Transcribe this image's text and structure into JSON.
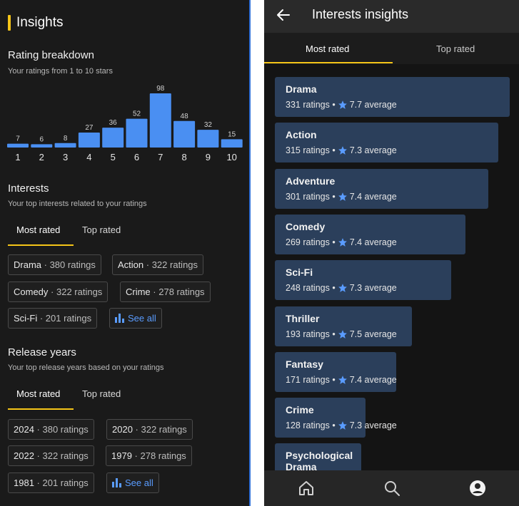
{
  "left": {
    "title": "Insights",
    "rating_breakdown": {
      "heading": "Rating breakdown",
      "subtitle": "Your ratings from 1 to 10 stars"
    },
    "interests": {
      "heading": "Interests",
      "subtitle": "Your top interests related to your ratings",
      "tabs": [
        "Most rated",
        "Top rated"
      ],
      "chips": [
        {
          "name": "Drama",
          "count": "· 380 ratings"
        },
        {
          "name": "Action",
          "count": "· 322 ratings"
        },
        {
          "name": "Comedy",
          "count": "· 322 ratings"
        },
        {
          "name": "Crime",
          "count": "· 278 ratings"
        },
        {
          "name": "Sci-Fi",
          "count": "· 201 ratings"
        }
      ],
      "see_all": "See all"
    },
    "release_years": {
      "heading": "Release years",
      "subtitle": "Your top release years based on your ratings",
      "tabs": [
        "Most rated",
        "Top rated"
      ],
      "chips": [
        {
          "name": "2024",
          "count": "· 380 ratings"
        },
        {
          "name": "2020",
          "count": "· 322 ratings"
        },
        {
          "name": "2022",
          "count": "· 322 ratings"
        },
        {
          "name": "1979",
          "count": "· 278 ratings"
        },
        {
          "name": "1981",
          "count": "· 201 ratings"
        }
      ],
      "see_all": "See all"
    }
  },
  "chart_data": {
    "type": "bar",
    "categories": [
      "1",
      "2",
      "3",
      "4",
      "5",
      "6",
      "7",
      "8",
      "9",
      "10"
    ],
    "values": [
      7,
      6,
      8,
      27,
      36,
      52,
      98,
      48,
      32,
      15
    ],
    "title": "Rating breakdown",
    "xlabel": "",
    "ylabel": "",
    "grid": false,
    "bar_color": "#4a8ff2"
  },
  "right": {
    "title": "Interests insights",
    "tabs": [
      "Most rated",
      "Top rated"
    ],
    "items": [
      {
        "name": "Drama",
        "ratings": "331 ratings •",
        "avg": "7.7 average",
        "count": 331
      },
      {
        "name": "Action",
        "ratings": "315 ratings •",
        "avg": "7.3 average",
        "count": 315
      },
      {
        "name": "Adventure",
        "ratings": "301 ratings •",
        "avg": "7.4 average",
        "count": 301
      },
      {
        "name": "Comedy",
        "ratings": "269 ratings •",
        "avg": "7.4 average",
        "count": 269
      },
      {
        "name": "Sci-Fi",
        "ratings": "248 ratings •",
        "avg": "7.3 average",
        "count": 248
      },
      {
        "name": "Thriller",
        "ratings": "193 ratings •",
        "avg": "7.5 average",
        "count": 193
      },
      {
        "name": "Fantasy",
        "ratings": "171 ratings •",
        "avg": "7.4 average",
        "count": 171
      },
      {
        "name": "Crime",
        "ratings": "128 ratings •",
        "avg": "7.3 average",
        "count": 128
      },
      {
        "name": "Psychological Drama",
        "ratings": "",
        "avg": "",
        "count": 122
      }
    ],
    "nav": [
      "home-icon",
      "search-icon",
      "profile-icon"
    ]
  },
  "colors": {
    "accent": "#f5c518",
    "bar": "#4a8ff2",
    "card": "#2b3f5b",
    "link": "#5a9cff"
  }
}
